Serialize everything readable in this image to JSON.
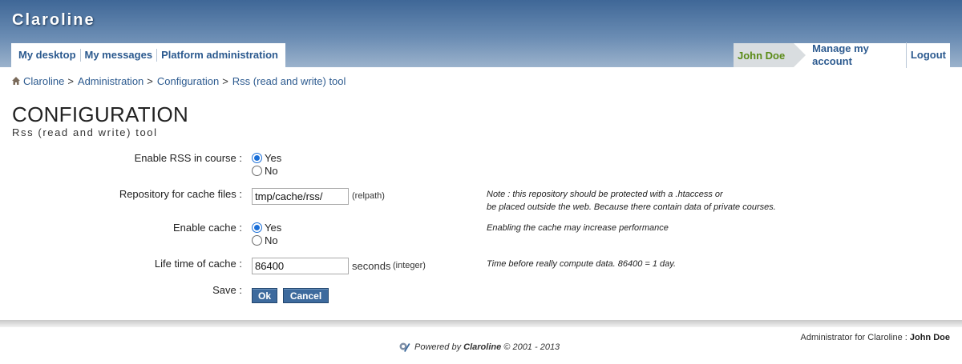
{
  "header": {
    "brand": "Claroline",
    "nav_left": [
      "My desktop",
      "My messages",
      "Platform administration"
    ],
    "user": "John Doe",
    "nav_right": [
      "Manage my account",
      "Logout"
    ]
  },
  "breadcrumb": [
    "Claroline",
    "Administration",
    "Configuration",
    "Rss (read and write) tool"
  ],
  "breadcrumb_sep": ">",
  "page": {
    "title": "CONFIGURATION",
    "subtitle": "Rss (read and write) tool"
  },
  "form": {
    "enable_rss": {
      "label": "Enable RSS in course :",
      "options": [
        "Yes",
        "No"
      ],
      "selected": "Yes"
    },
    "cache_repo": {
      "label": "Repository for cache files :",
      "value": "tmp/cache/rss/",
      "hint": "(relpath)",
      "note_line1": "Note : this repository should be protected with a .htaccess or",
      "note_line2": "be placed outside the web. Because there contain data of private courses."
    },
    "enable_cache": {
      "label": "Enable cache :",
      "options": [
        "Yes",
        "No"
      ],
      "selected": "Yes",
      "note": "Enabling the cache may increase performance"
    },
    "cache_lifetime": {
      "label": "Life time of cache :",
      "value": "86400",
      "unit": "seconds",
      "hint": "(integer)",
      "note": "Time before really compute data. 86400 = 1 day."
    },
    "save": {
      "label": "Save :",
      "ok": "Ok",
      "cancel": "Cancel"
    }
  },
  "footer": {
    "admin_label": "Administrator for Claroline :",
    "admin_name": "John Doe",
    "powered_prefix": "Powered by",
    "powered_brand": "Claroline",
    "powered_suffix": "© 2001 - 2013"
  },
  "colors": {
    "header_top": "#3f6797",
    "link": "#2c5a8f",
    "user_name": "#5b8b17",
    "button": "#3d6a9d",
    "radio_checked": "#1a6fd8"
  },
  "icons": [
    "home-icon",
    "claroline-logo-icon"
  ]
}
